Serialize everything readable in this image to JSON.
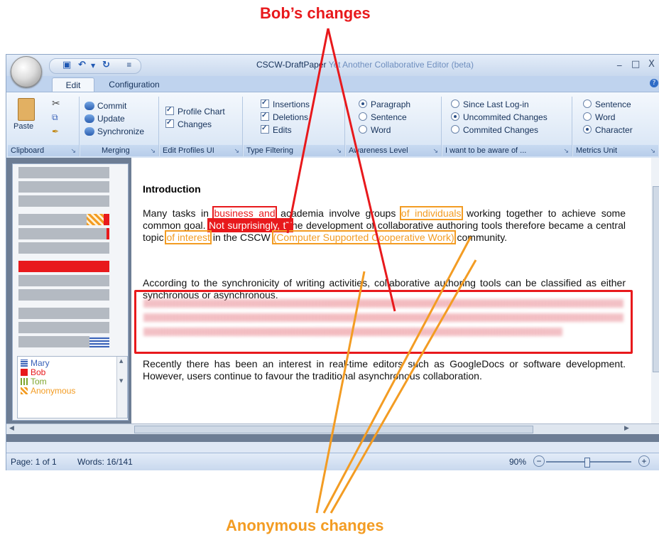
{
  "callouts": {
    "top": "Bob’s changes",
    "bottom": "Anonymous changes"
  },
  "colors": {
    "bob": "#e8191c",
    "anonymous": "#f39c23",
    "mary": "#3a62b8",
    "tom": "#7ea52e"
  },
  "window": {
    "title_doc": "CSCW-DraftPaper",
    "title_app": "Yet Another Collaborative Editor (beta)",
    "controls": [
      "_",
      "□",
      "X"
    ]
  },
  "quick_access": {
    "icons": [
      "save-icon",
      "undo-icon",
      "redo-icon",
      "customize-icon"
    ]
  },
  "tabs": [
    {
      "label": "Edit",
      "active": true
    },
    {
      "label": "Configuration",
      "active": false
    }
  ],
  "ribbon": {
    "clipboard": {
      "label": "Clipboard",
      "paste": "Paste"
    },
    "merging": {
      "label": "Merging",
      "items": [
        "Commit",
        "Update",
        "Synchronize"
      ]
    },
    "edit_profiles": {
      "label": "Edit Profiles UI",
      "items": [
        {
          "label": "Profile Chart",
          "checked": true
        },
        {
          "label": "Changes",
          "checked": true
        }
      ]
    },
    "type_filtering": {
      "label": "Type Filtering",
      "items": [
        {
          "label": "Insertions",
          "checked": true
        },
        {
          "label": "Deletions",
          "checked": true
        },
        {
          "label": "Edits",
          "checked": true
        }
      ]
    },
    "awareness": {
      "label": "Awareness Level",
      "items": [
        {
          "label": "Paragraph",
          "checked": true
        },
        {
          "label": "Sentence",
          "checked": false
        },
        {
          "label": "Word",
          "checked": false
        }
      ]
    },
    "aware_of": {
      "label": "I want to be aware of ...",
      "items": [
        {
          "label": "Since Last Log-in",
          "checked": false
        },
        {
          "label": "Uncommited Changes",
          "checked": true
        },
        {
          "label": "Commited Changes",
          "checked": false
        }
      ]
    },
    "metrics": {
      "label": "Metrics Unit",
      "items": [
        {
          "label": "Sentence",
          "checked": false
        },
        {
          "label": "Word",
          "checked": false
        },
        {
          "label": "Character",
          "checked": true
        }
      ]
    }
  },
  "legend": [
    {
      "name": "Mary",
      "color": "#3a62b8"
    },
    {
      "name": "Bob",
      "color": "#e8191c"
    },
    {
      "name": "Tom",
      "color": "#7ea52e"
    },
    {
      "name": "Anonymous",
      "color": "#f39c23"
    }
  ],
  "document": {
    "heading": "Introduction",
    "p1": {
      "a": "Many tasks in ",
      "b": "business and",
      "c": " academia involve groups ",
      "d": "of individuals",
      "e": " working together to achieve some common goal. ",
      "f": "Not surprisingly, tT",
      "g": "he development of collaborative authoring tools therefore became a central topic ",
      "h": "of interest",
      "i": " in the CSCW ",
      "j": "(Computer Supported Cooperative Work)",
      "k": " community."
    },
    "p2": "According to the synchronicity of writing activities, collaborative authoring tools can be classified as either synchronous or asynchronous.",
    "p3": "Recently there has been an interest in real-time editors such as GoogleDocs or software development. However, users continue to favour the traditional asynchronous collaboration."
  },
  "status": {
    "page": "Page: 1 of 1",
    "words": "Words: 16/141",
    "zoom": "90%",
    "zoom_minus": "−",
    "zoom_plus": "+"
  }
}
